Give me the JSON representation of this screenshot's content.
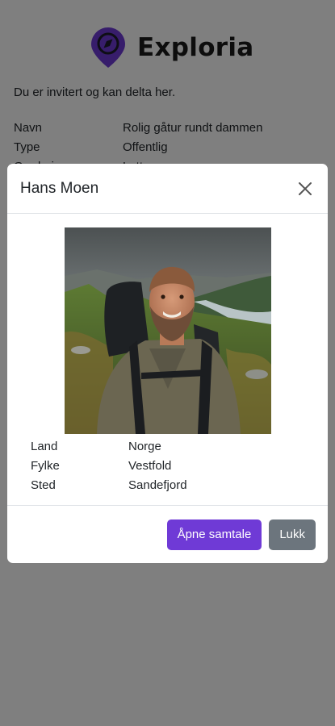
{
  "brand": {
    "name": "Exploria",
    "accent": "#6f3ad6"
  },
  "invite_text": "Du er invitert og kan delta her.",
  "info": [
    {
      "label": "Navn",
      "value": "Rolig gåtur rundt dammen"
    },
    {
      "label": "Type",
      "value": "Offentlig"
    },
    {
      "label": "Gradering",
      "value": "Lett"
    }
  ],
  "modal": {
    "title": "Hans Moen",
    "details": [
      {
        "label": "Land",
        "value": "Norge"
      },
      {
        "label": "Fylke",
        "value": "Vestfold"
      },
      {
        "label": "Sted",
        "value": "Sandefjord"
      }
    ],
    "open_chat_label": "Åpne samtale",
    "close_label": "Lukk"
  }
}
